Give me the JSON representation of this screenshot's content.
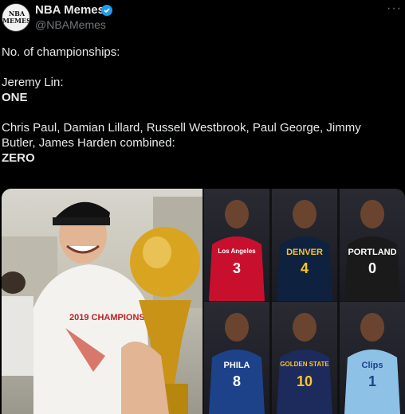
{
  "author": {
    "display_name": "NBA Memes",
    "handle": "@NBAMemes",
    "avatar_text": "NBA\nMEMES",
    "verified_color": "#1d9bf0"
  },
  "more_label": "···",
  "tweet": {
    "lines": [
      {
        "text": "No. of championships:",
        "bold": false
      },
      {
        "text": "",
        "bold": false
      },
      {
        "text": "Jeremy Lin:",
        "bold": false
      },
      {
        "text": "ONE",
        "bold": true
      },
      {
        "text": "",
        "bold": false
      },
      {
        "text": "Chris Paul, Damian Lillard, Russell Westbrook, Paul George, Jimmy",
        "bold": false
      },
      {
        "text": "Butler, James Harden combined:",
        "bold": false
      },
      {
        "text": "ZERO",
        "bold": true
      }
    ]
  },
  "media": {
    "trophy_banner": "2019 CHAMPIONS",
    "jerseys": [
      {
        "team": "Los Angeles",
        "number": "3",
        "color": "#c8102e"
      },
      {
        "team": "DENVER",
        "number": "4",
        "color": "#0e2240"
      },
      {
        "team": "PORTLAND",
        "number": "0",
        "color": "#1a1a1a"
      },
      {
        "team": "PHILA",
        "number": "8",
        "color": "#1d428a"
      },
      {
        "team": "GOLDEN STATE",
        "number": "10",
        "color": "#1d2a5c"
      },
      {
        "team": "Clips",
        "number": "1",
        "color": "#8ec1e6"
      }
    ]
  }
}
